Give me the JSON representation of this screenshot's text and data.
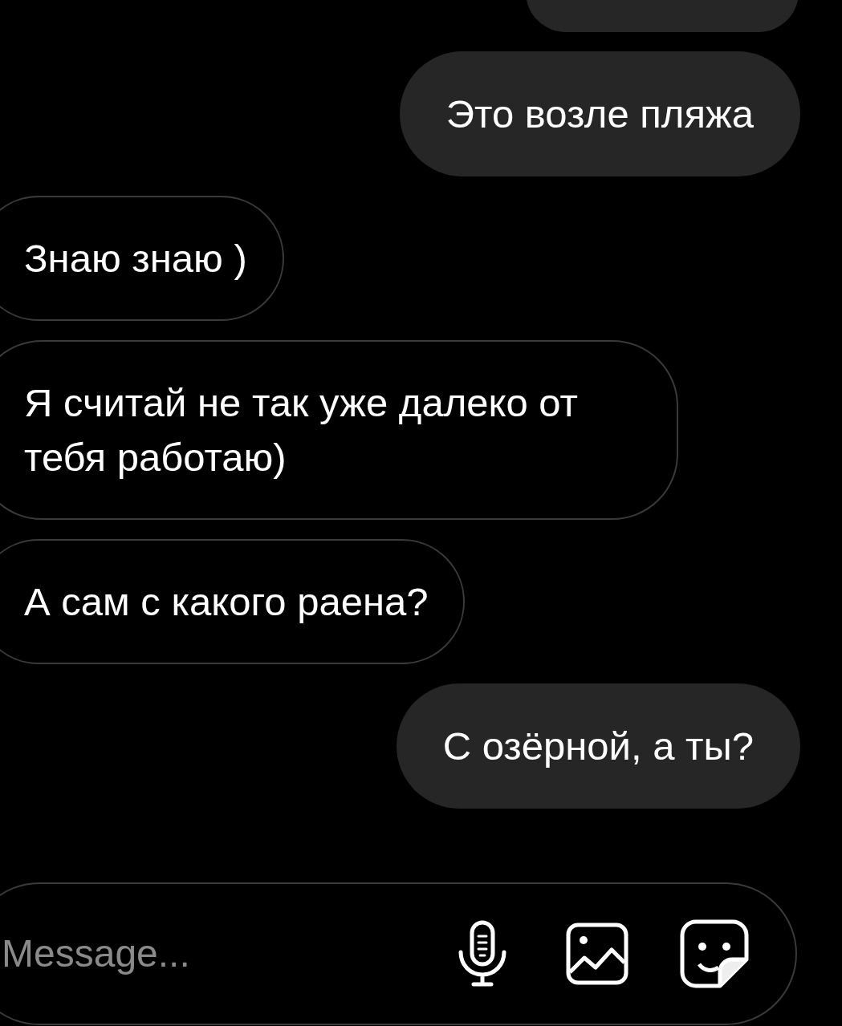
{
  "messages": [
    {
      "kind": "sent"
    },
    {
      "kind": "sent",
      "text": "Это возле пляжа"
    },
    {
      "kind": "received",
      "text": "Знаю знаю )"
    },
    {
      "kind": "received",
      "text": "Я считай не так уже далеко от тебя работаю)"
    },
    {
      "kind": "received",
      "text": "А сам с какого раена?"
    },
    {
      "kind": "sent",
      "text": "С озёрной, а ты?"
    }
  ],
  "composer": {
    "placeholder": "Message..."
  }
}
